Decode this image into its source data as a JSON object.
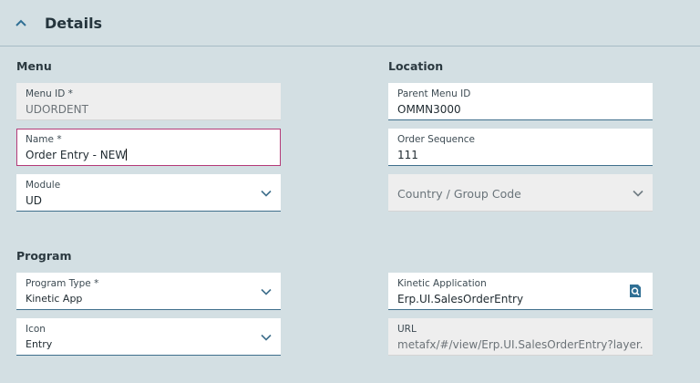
{
  "header": {
    "title": "Details",
    "collapse_icon": "chevron-up-icon"
  },
  "sections": {
    "menu": "Menu",
    "location": "Location",
    "program": "Program"
  },
  "fields": {
    "menu_id": {
      "label": "Menu ID *",
      "value": "UDORDENT"
    },
    "name": {
      "label": "Name *",
      "value": "Order Entry - NEW"
    },
    "module": {
      "label": "Module",
      "value": "UD"
    },
    "parent_menu_id": {
      "label": "Parent Menu ID",
      "value": "OMMN3000"
    },
    "order_sequence": {
      "label": "Order Sequence",
      "value": "111"
    },
    "country_group_code": {
      "placeholder": "Country / Group Code"
    },
    "program_type": {
      "label": "Program Type *",
      "value": "Kinetic App"
    },
    "icon": {
      "label": "Icon",
      "value": "Entry"
    },
    "kinetic_application": {
      "label": "Kinetic Application",
      "value": "Erp.UI.SalesOrderEntry",
      "action_icon": "search-lookup-icon"
    },
    "url": {
      "label": "URL",
      "value": "metafx/#/view/Erp.UI.SalesOrderEntry?layer..."
    }
  },
  "colors": {
    "background": "#d3dfe3",
    "accent": "#3f6f8c",
    "focus": "#b43a78"
  }
}
